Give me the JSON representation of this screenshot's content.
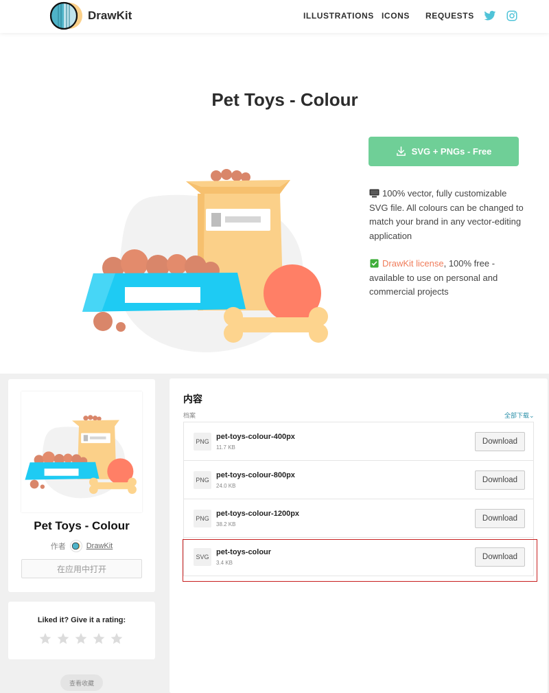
{
  "header": {
    "brand": "DrawKit",
    "nav": [
      "ILLUSTRATIONS",
      "ICONS",
      "REQUESTS"
    ],
    "social": [
      "twitter-icon",
      "instagram-icon"
    ]
  },
  "hero": {
    "title": "Pet Toys - Colour",
    "cta_label": "SVG + PNGs - Free",
    "feature1": "100% vector, fully customizable SVG file. All colours can be changed to match your brand in any vector-editing application",
    "feature2_link": "DrawKit license",
    "feature2_rest": ", 100% free - available to use on personal and commercial projects"
  },
  "sidebar": {
    "title": "Pet Toys - Colour",
    "author_prefix": "作者",
    "author_name": "DrawKit",
    "open_in_app": "在应用中打开",
    "rating_prompt": "Liked it? Give it a rating:",
    "stars": 5,
    "view_collection": "查看收藏"
  },
  "contents": {
    "title": "内容",
    "files_label": "档案",
    "download_all": "全部下载",
    "download_label": "Download",
    "files": [
      {
        "type": "PNG",
        "name": "pet-toys-colour-400px",
        "size": "11.7 KB"
      },
      {
        "type": "PNG",
        "name": "pet-toys-colour-800px",
        "size": "24.0 KB"
      },
      {
        "type": "PNG",
        "name": "pet-toys-colour-1200px",
        "size": "38.2 KB"
      },
      {
        "type": "SVG",
        "name": "pet-toys-colour",
        "size": "3.4 KB"
      }
    ]
  },
  "colors": {
    "accent": "#6fcf97",
    "link": "#f07c5a",
    "bowl": "#1ecbf3",
    "bag": "#fbd089",
    "ball": "#ff7f66",
    "bone": "#fdd48e",
    "kibble": "#d9866a",
    "highlight": "#c81e1e"
  }
}
